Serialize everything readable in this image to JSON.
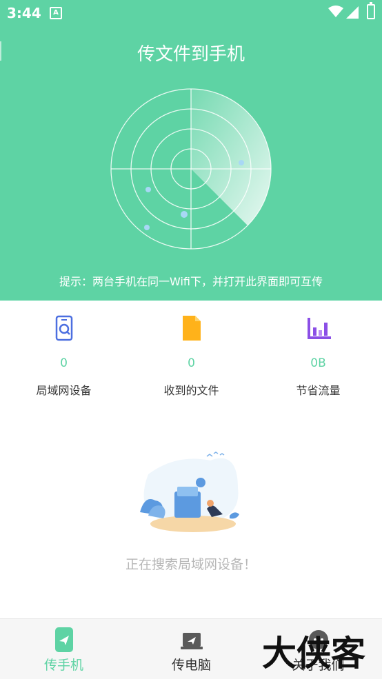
{
  "status_bar": {
    "time": "3:44",
    "notification_glyph": "A"
  },
  "header": {
    "title": "传文件到手机",
    "tip": "提示：两台手机在同一Wifi下，并打开此界面即可互传"
  },
  "stats": [
    {
      "value": "0",
      "label": "局域网设备",
      "icon": "phone-search-icon"
    },
    {
      "value": "0",
      "label": "收到的文件",
      "icon": "file-icon"
    },
    {
      "value": "0B",
      "label": "节省流量",
      "icon": "bar-chart-icon"
    }
  ],
  "empty_state": {
    "message": "正在搜索局域网设备！"
  },
  "bottom_nav": {
    "items": [
      {
        "label": "传手机",
        "icon": "send-phone-icon",
        "active": true
      },
      {
        "label": "传电脑",
        "icon": "send-computer-icon",
        "active": false
      },
      {
        "label": "关于我们",
        "icon": "about-icon",
        "active": false
      }
    ]
  },
  "watermark": {
    "text": "大侠客"
  },
  "colors": {
    "accent": "#5ED3A4",
    "stat_icon_blue": "#4C6FE0",
    "stat_icon_orange": "#FFB21A",
    "stat_icon_purple": "#8B4FE6"
  }
}
